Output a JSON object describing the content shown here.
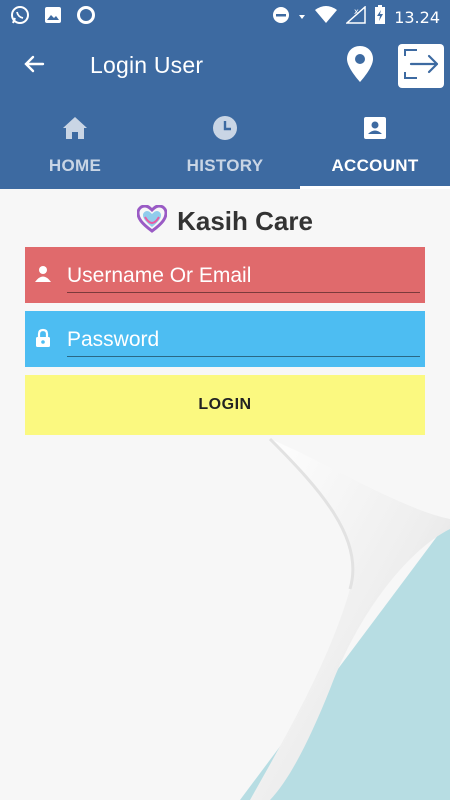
{
  "status_bar": {
    "time": "13.24",
    "icons": [
      "whatsapp-icon",
      "gallery-icon",
      "sync-icon",
      "do-not-disturb-icon",
      "wifi-icon",
      "signal-icon",
      "battery-charging-icon"
    ]
  },
  "app_bar": {
    "title": "Login User",
    "back_icon": "arrow-left-icon",
    "location_icon": "map-pin-icon",
    "logout_icon": "logout-icon"
  },
  "tabs": [
    {
      "label": "HOME",
      "icon": "home-icon",
      "active": false
    },
    {
      "label": "HISTORY",
      "icon": "clock-icon",
      "active": false
    },
    {
      "label": "ACCOUNT",
      "icon": "account-box-icon",
      "active": true
    }
  ],
  "brand": {
    "name": "Kasih Care",
    "logo_icon": "heart-logo-icon"
  },
  "form": {
    "username_placeholder": "Username Or Email",
    "password_placeholder": "Password",
    "login_label": "LOGIN"
  },
  "colors": {
    "primary": "#3d6aa1",
    "username_field": "#e06a6c",
    "password_field": "#4dbdf2",
    "login_button": "#fbf980",
    "background_curl": "#b7dde3"
  }
}
